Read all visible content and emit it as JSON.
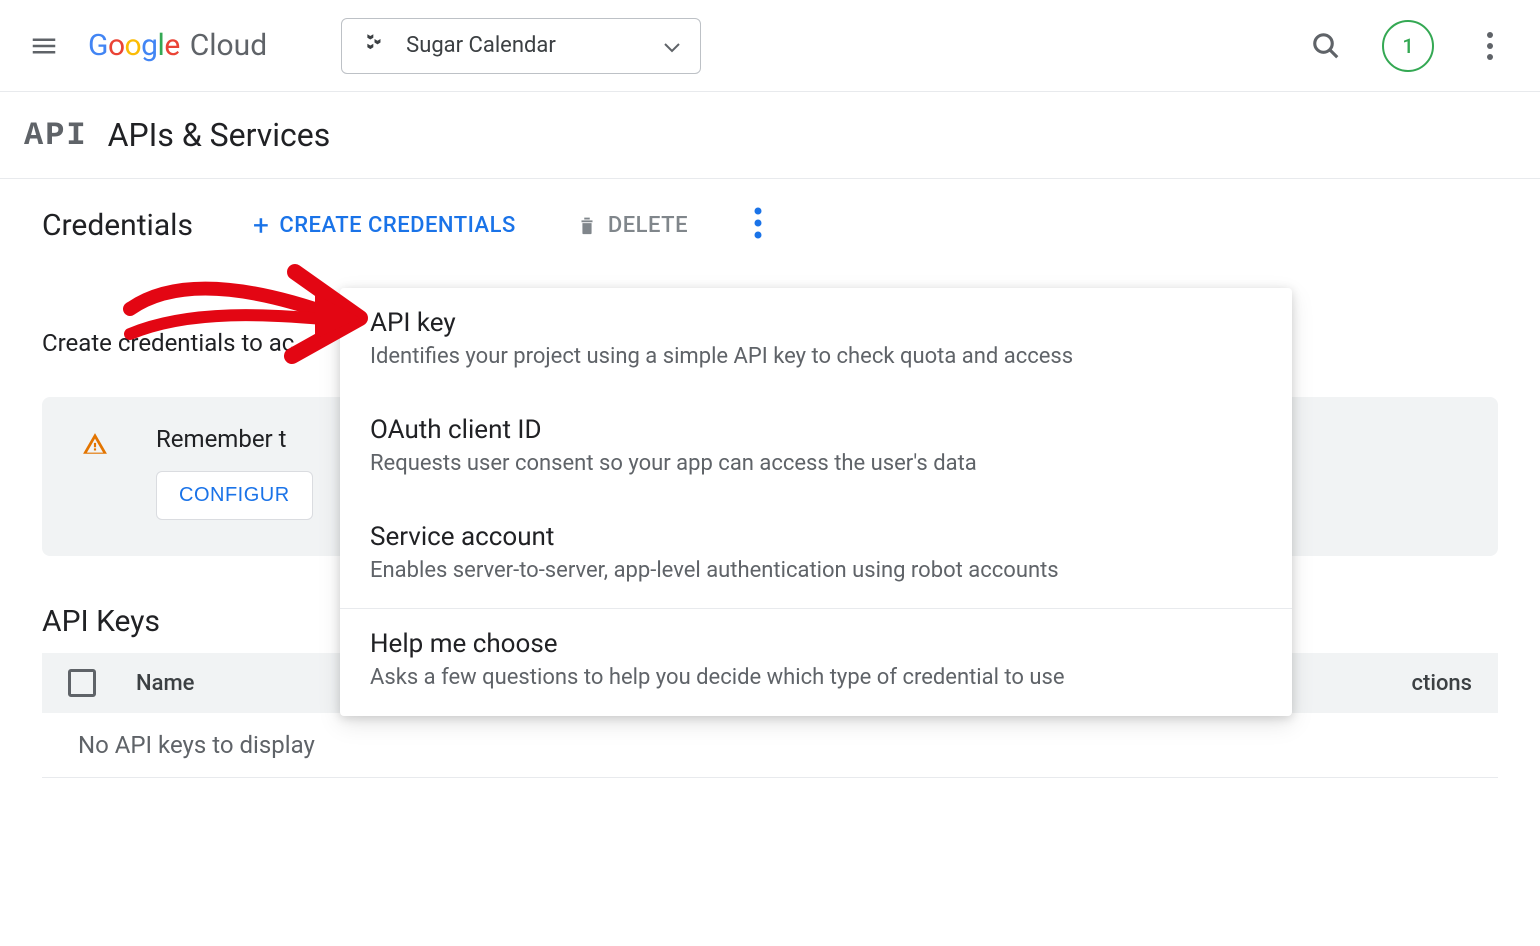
{
  "header": {
    "logo_google": "Google",
    "logo_cloud": "Cloud",
    "project_name": "Sugar Calendar",
    "trial_badge": "1"
  },
  "section": {
    "icon_text": "API",
    "title": "APIs & Services"
  },
  "actionbar": {
    "page_title": "Credentials",
    "create_label": "CREATE CREDENTIALS",
    "delete_label": "DELETE"
  },
  "helper_text": "Create credentials to ac",
  "alert": {
    "text": "Remember t",
    "button": "CONFIGUR"
  },
  "dropdown": {
    "items": [
      {
        "title": "API key",
        "desc": "Identifies your project using a simple API key to check quota and access"
      },
      {
        "title": "OAuth client ID",
        "desc": "Requests user consent so your app can access the user's data"
      },
      {
        "title": "Service account",
        "desc": "Enables server-to-server, app-level authentication using robot accounts"
      },
      {
        "title": "Help me choose",
        "desc": "Asks a few questions to help you decide which type of credential to use"
      }
    ]
  },
  "keys": {
    "title": "API Keys",
    "col_name": "Name",
    "col_actions": "ctions",
    "empty": "No API keys to display"
  }
}
